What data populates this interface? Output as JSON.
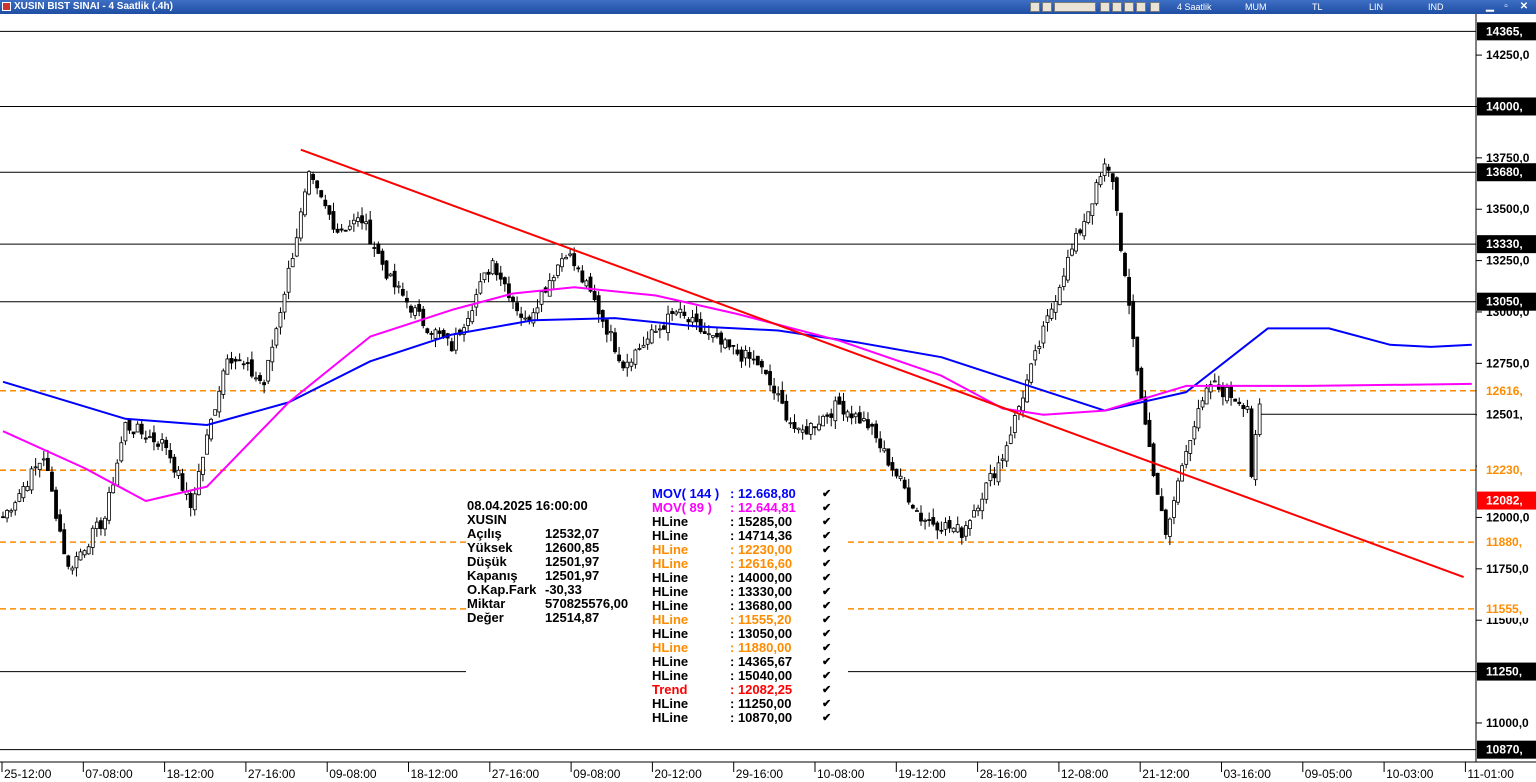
{
  "window": {
    "title": "XUSIN BIST SINAI - 4 Saatlik (.4h)",
    "toolbar": {
      "period": "4 Saatlik",
      "chart_type": "MUM",
      "currency": "TL",
      "scale": "LIN",
      "indicator": "IND"
    }
  },
  "info_panel": {
    "datetime": "08.04.2025  16:00:00",
    "symbol": "XUSIN",
    "rows": [
      {
        "label": "Açılış",
        "value": "12532,07"
      },
      {
        "label": "Yüksek",
        "value": "12600,85"
      },
      {
        "label": "Düşük",
        "value": "12501,97"
      },
      {
        "label": "Kapanış",
        "value": "12501,97"
      },
      {
        "label": "O.Kap.Fark",
        "value": "-30,33"
      },
      {
        "label": "Miktar",
        "value": "570825576,00"
      },
      {
        "label": "Değer",
        "value": "12514,87"
      }
    ]
  },
  "legend": [
    {
      "name": "MOV( 144 )",
      "value": ": 12.668,80",
      "color": "#0000ff"
    },
    {
      "name": "MOV( 89 )",
      "value": ": 12.644,81",
      "color": "#ff00ff"
    },
    {
      "name": "HLine",
      "value": ": 15285,00",
      "color": "#000000"
    },
    {
      "name": "HLine",
      "value": ": 14714,36",
      "color": "#000000"
    },
    {
      "name": "HLine",
      "value": ": 12230,00",
      "color": "#ff8c00"
    },
    {
      "name": "HLine",
      "value": ": 12616,60",
      "color": "#ff8c00"
    },
    {
      "name": "HLine",
      "value": ": 14000,00",
      "color": "#000000"
    },
    {
      "name": "HLine",
      "value": ": 13330,00",
      "color": "#000000"
    },
    {
      "name": "HLine",
      "value": ": 13680,00",
      "color": "#000000"
    },
    {
      "name": "HLine",
      "value": ": 11555,20",
      "color": "#ff8c00"
    },
    {
      "name": "HLine",
      "value": ": 13050,00",
      "color": "#000000"
    },
    {
      "name": "HLine",
      "value": ": 11880,00",
      "color": "#ff8c00"
    },
    {
      "name": "HLine",
      "value": ": 14365,67",
      "color": "#000000"
    },
    {
      "name": "HLine",
      "value": ": 15040,00",
      "color": "#000000"
    },
    {
      "name": "Trend",
      "value": ": 12082,25",
      "color": "#ff0000"
    },
    {
      "name": "HLine",
      "value": ": 11250,00",
      "color": "#000000"
    },
    {
      "name": "HLine",
      "value": ": 10870,00",
      "color": "#000000"
    }
  ],
  "chart_data": {
    "type": "candlestick",
    "ylim": [
      10810,
      14450
    ],
    "y_ticks": [
      "14250,0",
      "14000,",
      "13750,0",
      "13500,0",
      "13250,0",
      "13000,0",
      "12750,0",
      "12500,0",
      "12250,0",
      "12000,0",
      "11750,0",
      "11500,0",
      "11250,0",
      "11000,0"
    ],
    "y_tick_values": [
      14250,
      14000,
      13750,
      13500,
      13250,
      13000,
      12750,
      12500,
      12250,
      12000,
      11750,
      11500,
      11250,
      11000
    ],
    "x_ticks": [
      "25-12:00",
      "07-08:00",
      "18-12:00",
      "27-16:00",
      "09-08:00",
      "18-12:00",
      "27-16:00",
      "09-08:00",
      "20-12:00",
      "29-16:00",
      "10-08:00",
      "19-12:00",
      "28-16:00",
      "12-08:00",
      "21-12:00",
      "03-16:00",
      "09-05:00",
      "10-03:00",
      "11-01:00"
    ],
    "hlines": [
      {
        "value": 14365.67,
        "label": "14365,",
        "style": "solid",
        "color": "#000000"
      },
      {
        "value": 14000,
        "label": "14000,",
        "style": "solid",
        "color": "#000000"
      },
      {
        "value": 13680,
        "label": "13680,",
        "style": "solid",
        "color": "#000000"
      },
      {
        "value": 13330,
        "label": "13330,",
        "style": "solid",
        "color": "#000000"
      },
      {
        "value": 13050,
        "label": "13050,",
        "style": "solid",
        "color": "#000000"
      },
      {
        "value": 12616.6,
        "label": "12616,",
        "style": "dashed",
        "color": "#ff8c00"
      },
      {
        "value": 12230,
        "label": "12230,",
        "style": "dashed",
        "color": "#ff8c00"
      },
      {
        "value": 11880,
        "label": "11880,",
        "style": "dashed",
        "color": "#ff8c00"
      },
      {
        "value": 11555.2,
        "label": "11555,",
        "style": "dashed",
        "color": "#ff8c00"
      },
      {
        "value": 11250,
        "label": "11250,",
        "style": "solid",
        "color": "#000000"
      },
      {
        "value": 10870,
        "label": "10870,",
        "style": "solid",
        "color": "#000000"
      }
    ],
    "last_price": {
      "value": 12501.97,
      "label": "12501,"
    },
    "trend_value": {
      "value": 12082.25,
      "label": "12082,",
      "color": "#ff0000"
    },
    "trendline": {
      "start": {
        "candle": 73,
        "value": 13790
      },
      "end": {
        "candle": 358,
        "value": 11710
      },
      "color": "#ff0000"
    },
    "mov144": [
      [
        0,
        12660
      ],
      [
        30,
        12480
      ],
      [
        50,
        12450
      ],
      [
        70,
        12560
      ],
      [
        90,
        12760
      ],
      [
        110,
        12890
      ],
      [
        130,
        12960
      ],
      [
        150,
        12970
      ],
      [
        170,
        12930
      ],
      [
        190,
        12910
      ],
      [
        210,
        12850
      ],
      [
        230,
        12780
      ],
      [
        250,
        12650
      ],
      [
        270,
        12520
      ],
      [
        290,
        12610
      ],
      [
        310,
        12920
      ],
      [
        325,
        12920
      ],
      [
        340,
        12840
      ],
      [
        350,
        12830
      ],
      [
        360,
        12840
      ]
    ],
    "mov89": [
      [
        0,
        12420
      ],
      [
        20,
        12240
      ],
      [
        35,
        12080
      ],
      [
        50,
        12150
      ],
      [
        70,
        12560
      ],
      [
        90,
        12880
      ],
      [
        110,
        13010
      ],
      [
        125,
        13090
      ],
      [
        140,
        13120
      ],
      [
        160,
        13080
      ],
      [
        180,
        12990
      ],
      [
        205,
        12860
      ],
      [
        230,
        12690
      ],
      [
        245,
        12530
      ],
      [
        255,
        12500
      ],
      [
        270,
        12520
      ],
      [
        290,
        12640
      ],
      [
        310,
        12640
      ],
      [
        320,
        12640
      ],
      [
        360,
        12650
      ]
    ],
    "price_path": [
      [
        0,
        12000
      ],
      [
        10,
        12300
      ],
      [
        16,
        11750
      ],
      [
        25,
        12000
      ],
      [
        30,
        12450
      ],
      [
        40,
        12350
      ],
      [
        46,
        12050
      ],
      [
        55,
        12800
      ],
      [
        64,
        12650
      ],
      [
        75,
        13650
      ],
      [
        82,
        13400
      ],
      [
        88,
        13450
      ],
      [
        95,
        13150
      ],
      [
        103,
        12950
      ],
      [
        110,
        12830
      ],
      [
        120,
        13250
      ],
      [
        128,
        12950
      ],
      [
        138,
        13300
      ],
      [
        145,
        13050
      ],
      [
        152,
        12750
      ],
      [
        165,
        13000
      ],
      [
        175,
        12850
      ],
      [
        185,
        12750
      ],
      [
        195,
        12400
      ],
      [
        205,
        12550
      ],
      [
        212,
        12450
      ],
      [
        225,
        12000
      ],
      [
        235,
        11930
      ],
      [
        245,
        12300
      ],
      [
        250,
        12600
      ],
      [
        260,
        13200
      ],
      [
        270,
        13700
      ],
      [
        272,
        13650
      ],
      [
        276,
        13000
      ],
      [
        280,
        12450
      ],
      [
        285,
        11900
      ],
      [
        290,
        12350
      ],
      [
        296,
        12650
      ],
      [
        305,
        12550
      ],
      [
        305,
        12050
      ],
      [
        308,
        12530
      ]
    ]
  }
}
